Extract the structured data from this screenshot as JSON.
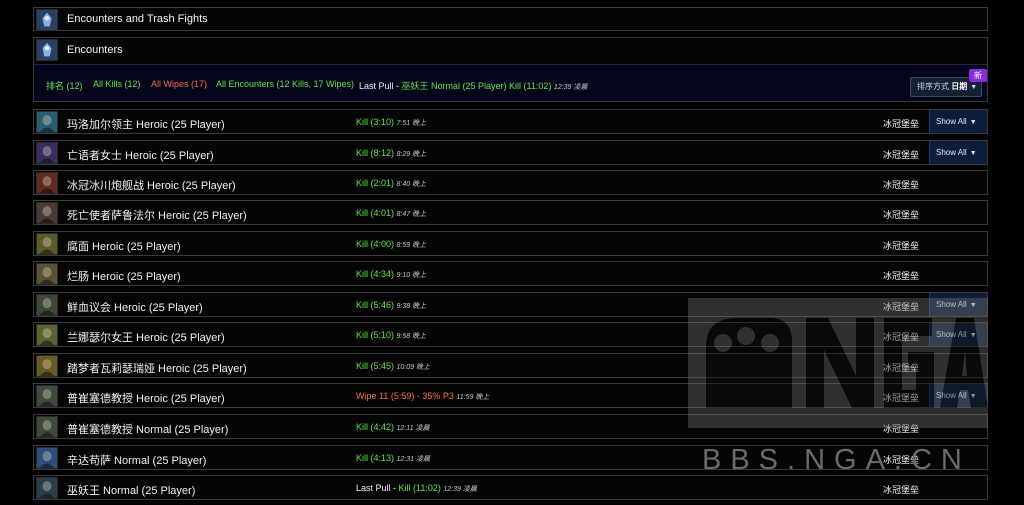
{
  "sections": [
    {
      "title": "Encounters and Trash Fights"
    },
    {
      "title": "Encounters"
    }
  ],
  "filters": {
    "rank": "排名 (12)",
    "all_kills": "All Kills (12)",
    "all_wipes": "All Wipes (17)",
    "all_encounters": "All Encounters (12 Kills, 17 Wipes)",
    "last_pull_label": "Last Pull - ",
    "last_pull_value": "巫妖王 Normal (25 Player) Kill (11:02)",
    "last_pull_time": "12:39 凌晨",
    "sort_label": "排序方式",
    "sort_value": "日期",
    "new_badge": "新"
  },
  "rows": [
    {
      "name": "玛洛加尔领主 Heroic (25 Player)",
      "result": "Kill (3:10)",
      "status": "kill",
      "time": "7:51 晚上",
      "zone": "冰冠堡垒",
      "show_all": "Show All",
      "icon_color": "#2a5e6e"
    },
    {
      "name": "亡语者女士 Heroic (25 Player)",
      "result": "Kill (8:12)",
      "status": "kill",
      "time": "8:29 晚上",
      "zone": "冰冠堡垒",
      "show_all": "Show All",
      "icon_color": "#3a2e5e"
    },
    {
      "name": "冰冠冰川炮舰战 Heroic (25 Player)",
      "result": "Kill (2:01)",
      "status": "kill",
      "time": "8:40 晚上",
      "zone": "冰冠堡垒",
      "show_all": "",
      "icon_color": "#5e2a22"
    },
    {
      "name": "死亡使者萨鲁法尔 Heroic (25 Player)",
      "result": "Kill (4:01)",
      "status": "kill",
      "time": "8:47 晚上",
      "zone": "冰冠堡垒",
      "show_all": "",
      "icon_color": "#4a3a34"
    },
    {
      "name": "腐面 Heroic (25 Player)",
      "result": "Kill (4:00)",
      "status": "kill",
      "time": "8:59 晚上",
      "zone": "冰冠堡垒",
      "show_all": "",
      "icon_color": "#5e5a28"
    },
    {
      "name": "烂肠 Heroic (25 Player)",
      "result": "Kill (4:34)",
      "status": "kill",
      "time": "9:10 晚上",
      "zone": "冰冠堡垒",
      "show_all": "",
      "icon_color": "#5a5234"
    },
    {
      "name": "鲜血议会 Heroic (25 Player)",
      "result": "Kill (5:46)",
      "status": "kill",
      "time": "9:38 晚上",
      "zone": "冰冠堡垒",
      "show_all": "Show All",
      "icon_color": "#3a4a36"
    },
    {
      "name": "兰娜瑟尔女王 Heroic (25 Player)",
      "result": "Kill (5:10)",
      "status": "kill",
      "time": "9:58 晚上",
      "zone": "冰冠堡垒",
      "show_all": "Show All",
      "icon_color": "#5e6232"
    },
    {
      "name": "踏梦者瓦莉瑟瑞娅 Heroic (25 Player)",
      "result": "Kill (5:45)",
      "status": "kill",
      "time": "10:09 晚上",
      "zone": "冰冠堡垒",
      "show_all": "",
      "icon_color": "#6a5a22"
    },
    {
      "name": "普崔塞德教授 Heroic (25 Player)",
      "result": "Wipe 11 (5:59) - 35% P3",
      "status": "wipe",
      "time": "11:59 晚上",
      "zone": "冰冠堡垒",
      "show_all": "Show All",
      "icon_color": "#3e4a3a"
    },
    {
      "name": "普崔塞德教授 Normal (25 Player)",
      "result": "Kill (4:42)",
      "status": "kill",
      "time": "12:11 凌晨",
      "zone": "冰冠堡垒",
      "show_all": "",
      "icon_color": "#3e4a3a"
    },
    {
      "name": "辛达苟萨 Normal (25 Player)",
      "result": "Kill (4:13)",
      "status": "kill",
      "time": "12:31 凌晨",
      "zone": "冰冠堡垒",
      "show_all": "",
      "icon_color": "#2e4e76"
    },
    {
      "name": "巫妖王 Normal (25 Player)",
      "result": "Kill (11:02)",
      "status": "lastpull",
      "prefix": "Last Pull - ",
      "time": "12:39 凌晨",
      "zone": "冰冠堡垒",
      "show_all": "",
      "icon_color": "#2a3e4e"
    }
  ],
  "watermark": {
    "text": "BBS.NGA.CN"
  }
}
